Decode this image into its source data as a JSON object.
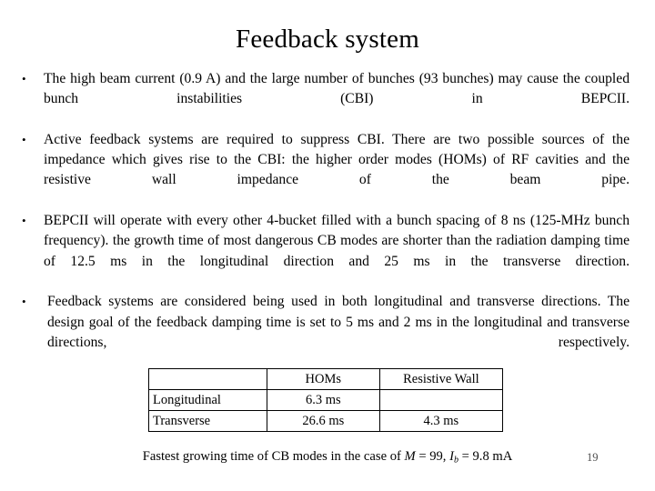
{
  "slide": {
    "title": "Feedback system",
    "bullets": [
      {
        "marker": "•",
        "text": "The high beam current (0.9 A) and the large number of bunches (93 bunches) may cause the coupled bunch instabilities (CBI) in BEPCII."
      },
      {
        "marker": "•",
        "text": "Active feedback systems are required to suppress CBI. There are two possible sources of the impedance which gives rise to the CBI: the higher order modes (HOMs) of RF cavities and the resistive wall impedance of the beam pipe."
      },
      {
        "marker": "•",
        "text": "BEPCII will operate with every other 4-bucket filled with a bunch spacing of 8 ns (125-MHz bunch frequency). the growth time of most dangerous CB modes are shorter than the radiation damping time of 12.5 ms in the longitudinal direction and 25 ms in the transverse direction."
      },
      {
        "marker": "•",
        "text": "Feedback systems are considered being used in both longitudinal and transverse directions. The design goal of the feedback damping time is set to 5 ms and 2 ms in the longitudinal and transverse directions, respectively."
      }
    ],
    "table": {
      "headers": [
        "",
        "HOMs",
        "Resistive Wall"
      ],
      "rows": [
        [
          "Longitudinal",
          "6.3 ms",
          ""
        ],
        [
          "Transverse",
          "26.6 ms",
          "4.3 ms"
        ]
      ]
    },
    "caption": {
      "part1": "Fastest growing time of CB modes in the case of ",
      "sym_m": "M",
      "eq_m": " = 99, ",
      "sym_i": "I",
      "sub_i": "b",
      "eq_i": " = 9.8 mA"
    },
    "page_number": "19"
  }
}
